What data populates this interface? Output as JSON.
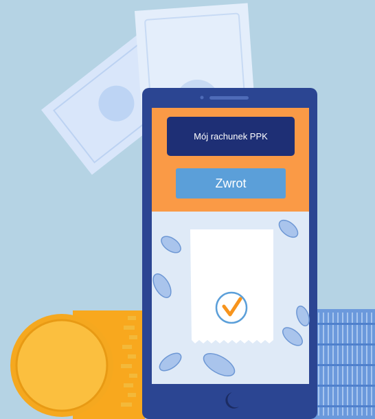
{
  "app": {
    "account_button_label": "Mój rachunek PPK",
    "refund_button_label": "Zwrot"
  },
  "icons": {
    "receipt_status": "checkmark-icon",
    "home": "home-button-icon"
  },
  "colors": {
    "background": "#b5d3e4",
    "phone_body": "#2b4592",
    "header_orange": "#fa9a46",
    "account_button": "#1e2f75",
    "refund_button": "#5b9fd9",
    "content_bg": "#dfeaf7",
    "check_accent": "#f7941d",
    "coin_gold": "#f9ad1c"
  }
}
